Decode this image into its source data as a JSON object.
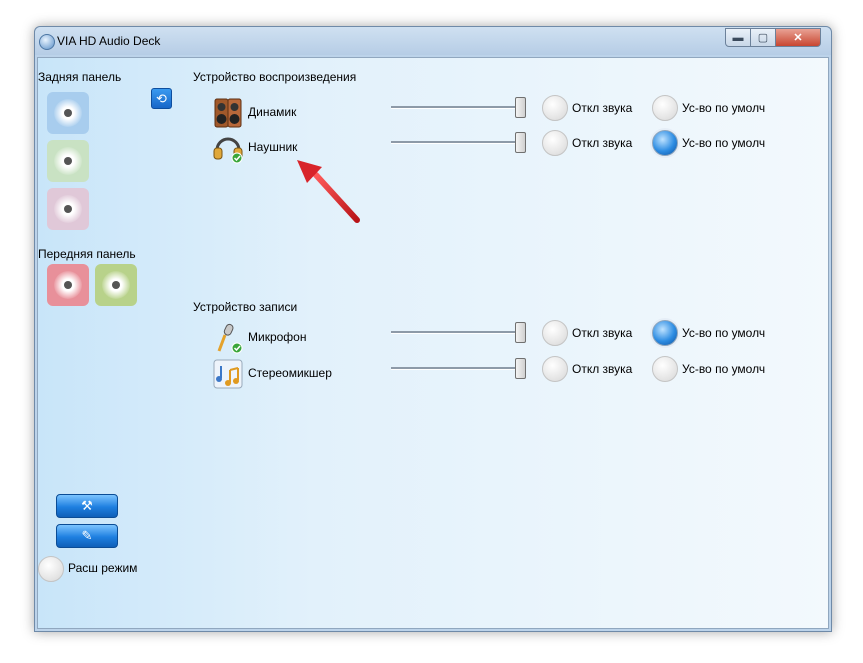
{
  "window": {
    "title": "VIA HD Audio Deck",
    "controls": {
      "minimize": "▬",
      "maximize": "▢",
      "close": "✕"
    }
  },
  "left_panel": {
    "rear_label": "Задняя панель",
    "front_label": "Передняя панель",
    "refresh_glyph": "⟲",
    "rear_jacks": [
      {
        "name": "blue",
        "color": "#a8cdee"
      },
      {
        "name": "green",
        "color": "#c9e2c3"
      },
      {
        "name": "pink",
        "color": "#e0c8d8"
      }
    ],
    "front_jacks": [
      {
        "name": "pink",
        "color": "#e8909a"
      },
      {
        "name": "green",
        "color": "#b8d28a"
      }
    ],
    "tool_buttons": [
      {
        "glyph": "⚒"
      },
      {
        "glyph": "✎"
      }
    ],
    "advanced_mode_label": "Расш режим"
  },
  "playback": {
    "section_label": "Устройство воспроизведения",
    "devices": [
      {
        "label": "Динамик",
        "icon": "speaker-icon",
        "volume": 1.0,
        "mute_label": "Откл звука",
        "muted": false,
        "default_label": "Ус-во по умолч",
        "is_default": false
      },
      {
        "label": "Наушник",
        "icon": "headphones-icon",
        "volume": 1.0,
        "mute_label": "Откл звука",
        "muted": false,
        "default_label": "Ус-во по умолч",
        "is_default": true
      }
    ]
  },
  "recording": {
    "section_label": "Устройство записи",
    "devices": [
      {
        "label": "Микрофон",
        "icon": "microphone-icon",
        "volume": 1.0,
        "mute_label": "Откл звука",
        "muted": false,
        "default_label": "Ус-во по умолч",
        "is_default": true
      },
      {
        "label": "Стереомикшер",
        "icon": "stereo-mixer-icon",
        "volume": 1.0,
        "mute_label": "Откл звука",
        "muted": false,
        "default_label": "Ус-во по умолч",
        "is_default": false
      }
    ]
  },
  "colors": {
    "arrow": "#d8242a",
    "radio_on": "#2e8de3",
    "tool_button": "#1e7fe0"
  }
}
